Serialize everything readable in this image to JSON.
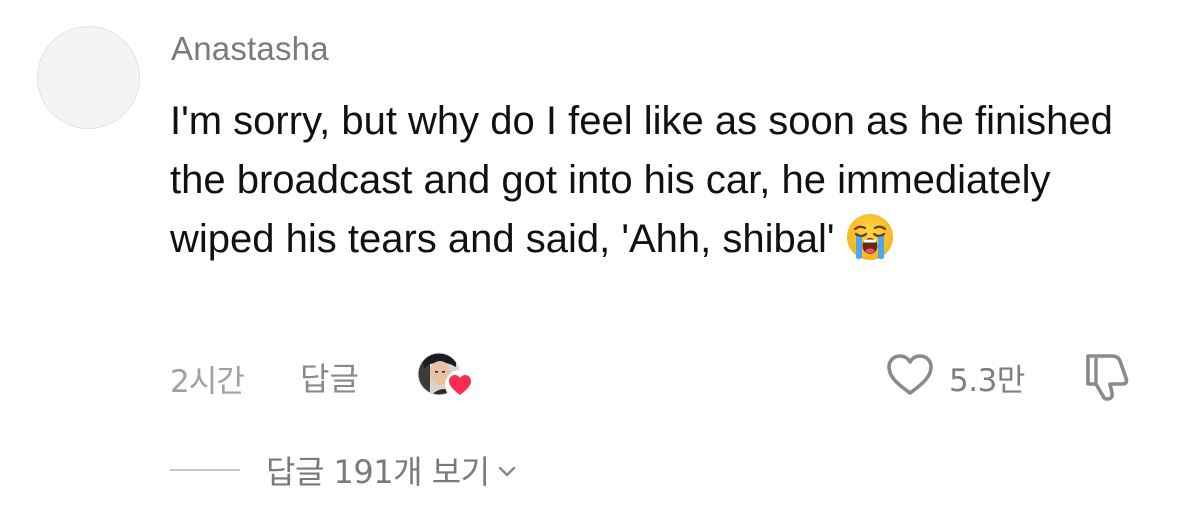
{
  "comment": {
    "username": "Anastasha",
    "text": "I'm sorry, but why do I feel like as soon as he finished the broadcast and got into his car, he immediately wiped his tears and said, 'Ahh, shibal'",
    "emoji": "loudly-crying-face",
    "time": "2시간",
    "reply_label": "답글",
    "like_count": "5.3만",
    "liked_by_creator": true
  },
  "replies": {
    "view_label": "답글 191개 보기"
  },
  "icons": {
    "like": "heart-outline-icon",
    "dislike": "thumbs-down-icon",
    "expand": "chevron-down-icon",
    "creator_heart_color": "#fe2c55"
  }
}
